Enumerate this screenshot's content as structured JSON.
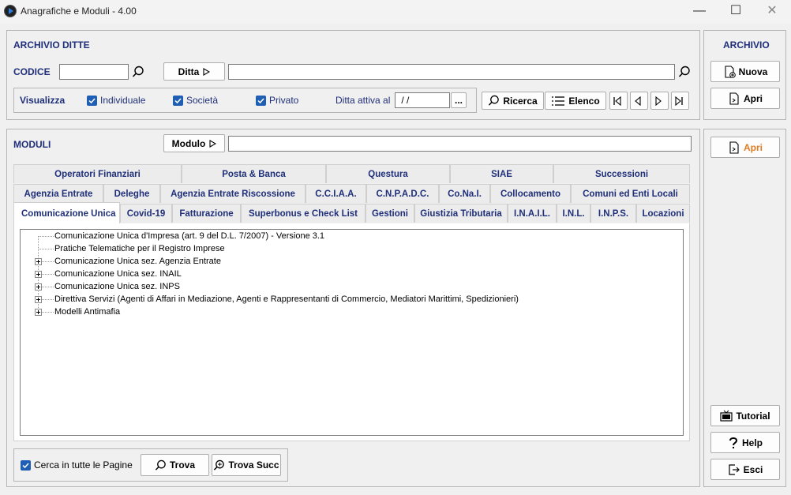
{
  "window": {
    "title": "Anagrafiche e Moduli - 4.00",
    "minimize": "—",
    "maximize": "☐",
    "close": "✕"
  },
  "archivio": {
    "title": "ARCHIVIO DITTE",
    "codice_label": "CODICE",
    "codice_value": "",
    "ditta_button": "Ditta",
    "ditta_value": "",
    "visualizza_label": "Visualizza",
    "individuale": "Individuale",
    "societa": "Società",
    "privato": "Privato",
    "ditta_attiva_label": "Ditta attiva al",
    "ditta_attiva_value": " / /",
    "ellipsis": "...",
    "ricerca": "Ricerca",
    "elenco": "Elenco"
  },
  "right_archivio": {
    "title": "ARCHIVIO",
    "nuova": "Nuova",
    "apri": "Apri"
  },
  "moduli": {
    "title": "MODULI",
    "modulo_button": "Modulo",
    "modulo_value": "",
    "tabs_row1": [
      "Operatori Finanziari",
      "Posta & Banca",
      "Questura",
      "SIAE",
      "Successioni"
    ],
    "tabs_row2": [
      "Agenzia Entrate",
      "Deleghe",
      "Agenzia Entrate Riscossione",
      "C.C.I.A.A.",
      "C.N.P.A.D.C.",
      "Co.Na.I.",
      "Collocamento",
      "Comuni ed Enti Locali"
    ],
    "tabs_row3": [
      "Comunicazione Unica",
      "Covid-19",
      "Fatturazione",
      "Superbonus e Check List",
      "Gestioni",
      "Giustizia Tributaria",
      "I.N.A.I.L.",
      "I.N.L.",
      "I.N.P.S.",
      "Locazioni"
    ],
    "tree": [
      "Comunicazione Unica d'Impresa (art. 9 del D.L. 7/2007) - Versione 3.1",
      "Pratiche Telematiche per il Registro Imprese",
      "Comunicazione Unica sez. Agenzia Entrate",
      "Comunicazione Unica sez. INAIL",
      "Comunicazione Unica sez. INPS",
      "Direttiva Servizi  (Agenti di Affari in Mediazione, Agenti e Rappresentanti di Commercio, Mediatori Marittimi, Spedizionieri)",
      "Modelli Antimafia"
    ],
    "cerca_label": "Cerca in tutte le Pagine",
    "trova": "Trova",
    "trova_succ": "Trova Succ"
  },
  "right_moduli": {
    "apri": "Apri",
    "tutorial": "Tutorial",
    "help": "Help",
    "esci": "Esci"
  },
  "colors": {
    "accent": "#1f2f7a",
    "apri_orange": "#e07b24",
    "checkbox": "#1e5fb5"
  }
}
